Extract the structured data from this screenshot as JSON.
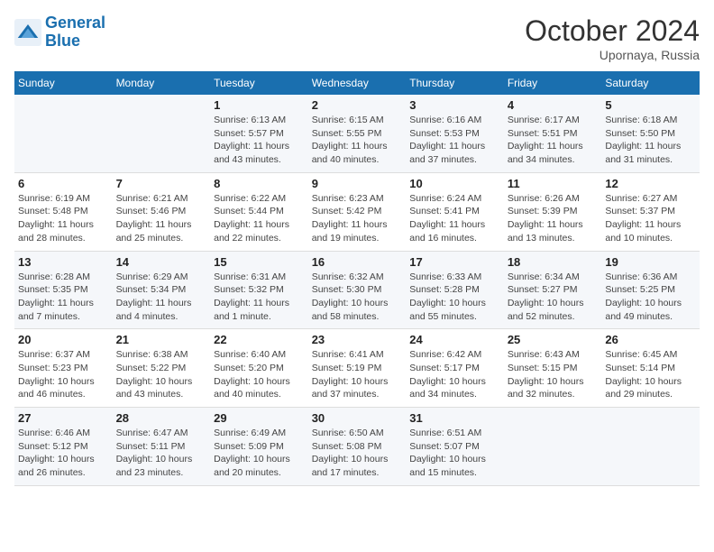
{
  "header": {
    "logo_line1": "General",
    "logo_line2": "Blue",
    "month": "October 2024",
    "location": "Upornaya, Russia"
  },
  "weekdays": [
    "Sunday",
    "Monday",
    "Tuesday",
    "Wednesday",
    "Thursday",
    "Friday",
    "Saturday"
  ],
  "weeks": [
    [
      {
        "day": "",
        "info": ""
      },
      {
        "day": "",
        "info": ""
      },
      {
        "day": "1",
        "info": "Sunrise: 6:13 AM\nSunset: 5:57 PM\nDaylight: 11 hours and 43 minutes."
      },
      {
        "day": "2",
        "info": "Sunrise: 6:15 AM\nSunset: 5:55 PM\nDaylight: 11 hours and 40 minutes."
      },
      {
        "day": "3",
        "info": "Sunrise: 6:16 AM\nSunset: 5:53 PM\nDaylight: 11 hours and 37 minutes."
      },
      {
        "day": "4",
        "info": "Sunrise: 6:17 AM\nSunset: 5:51 PM\nDaylight: 11 hours and 34 minutes."
      },
      {
        "day": "5",
        "info": "Sunrise: 6:18 AM\nSunset: 5:50 PM\nDaylight: 11 hours and 31 minutes."
      }
    ],
    [
      {
        "day": "6",
        "info": "Sunrise: 6:19 AM\nSunset: 5:48 PM\nDaylight: 11 hours and 28 minutes."
      },
      {
        "day": "7",
        "info": "Sunrise: 6:21 AM\nSunset: 5:46 PM\nDaylight: 11 hours and 25 minutes."
      },
      {
        "day": "8",
        "info": "Sunrise: 6:22 AM\nSunset: 5:44 PM\nDaylight: 11 hours and 22 minutes."
      },
      {
        "day": "9",
        "info": "Sunrise: 6:23 AM\nSunset: 5:42 PM\nDaylight: 11 hours and 19 minutes."
      },
      {
        "day": "10",
        "info": "Sunrise: 6:24 AM\nSunset: 5:41 PM\nDaylight: 11 hours and 16 minutes."
      },
      {
        "day": "11",
        "info": "Sunrise: 6:26 AM\nSunset: 5:39 PM\nDaylight: 11 hours and 13 minutes."
      },
      {
        "day": "12",
        "info": "Sunrise: 6:27 AM\nSunset: 5:37 PM\nDaylight: 11 hours and 10 minutes."
      }
    ],
    [
      {
        "day": "13",
        "info": "Sunrise: 6:28 AM\nSunset: 5:35 PM\nDaylight: 11 hours and 7 minutes."
      },
      {
        "day": "14",
        "info": "Sunrise: 6:29 AM\nSunset: 5:34 PM\nDaylight: 11 hours and 4 minutes."
      },
      {
        "day": "15",
        "info": "Sunrise: 6:31 AM\nSunset: 5:32 PM\nDaylight: 11 hours and 1 minute."
      },
      {
        "day": "16",
        "info": "Sunrise: 6:32 AM\nSunset: 5:30 PM\nDaylight: 10 hours and 58 minutes."
      },
      {
        "day": "17",
        "info": "Sunrise: 6:33 AM\nSunset: 5:28 PM\nDaylight: 10 hours and 55 minutes."
      },
      {
        "day": "18",
        "info": "Sunrise: 6:34 AM\nSunset: 5:27 PM\nDaylight: 10 hours and 52 minutes."
      },
      {
        "day": "19",
        "info": "Sunrise: 6:36 AM\nSunset: 5:25 PM\nDaylight: 10 hours and 49 minutes."
      }
    ],
    [
      {
        "day": "20",
        "info": "Sunrise: 6:37 AM\nSunset: 5:23 PM\nDaylight: 10 hours and 46 minutes."
      },
      {
        "day": "21",
        "info": "Sunrise: 6:38 AM\nSunset: 5:22 PM\nDaylight: 10 hours and 43 minutes."
      },
      {
        "day": "22",
        "info": "Sunrise: 6:40 AM\nSunset: 5:20 PM\nDaylight: 10 hours and 40 minutes."
      },
      {
        "day": "23",
        "info": "Sunrise: 6:41 AM\nSunset: 5:19 PM\nDaylight: 10 hours and 37 minutes."
      },
      {
        "day": "24",
        "info": "Sunrise: 6:42 AM\nSunset: 5:17 PM\nDaylight: 10 hours and 34 minutes."
      },
      {
        "day": "25",
        "info": "Sunrise: 6:43 AM\nSunset: 5:15 PM\nDaylight: 10 hours and 32 minutes."
      },
      {
        "day": "26",
        "info": "Sunrise: 6:45 AM\nSunset: 5:14 PM\nDaylight: 10 hours and 29 minutes."
      }
    ],
    [
      {
        "day": "27",
        "info": "Sunrise: 6:46 AM\nSunset: 5:12 PM\nDaylight: 10 hours and 26 minutes."
      },
      {
        "day": "28",
        "info": "Sunrise: 6:47 AM\nSunset: 5:11 PM\nDaylight: 10 hours and 23 minutes."
      },
      {
        "day": "29",
        "info": "Sunrise: 6:49 AM\nSunset: 5:09 PM\nDaylight: 10 hours and 20 minutes."
      },
      {
        "day": "30",
        "info": "Sunrise: 6:50 AM\nSunset: 5:08 PM\nDaylight: 10 hours and 17 minutes."
      },
      {
        "day": "31",
        "info": "Sunrise: 6:51 AM\nSunset: 5:07 PM\nDaylight: 10 hours and 15 minutes."
      },
      {
        "day": "",
        "info": ""
      },
      {
        "day": "",
        "info": ""
      }
    ]
  ]
}
